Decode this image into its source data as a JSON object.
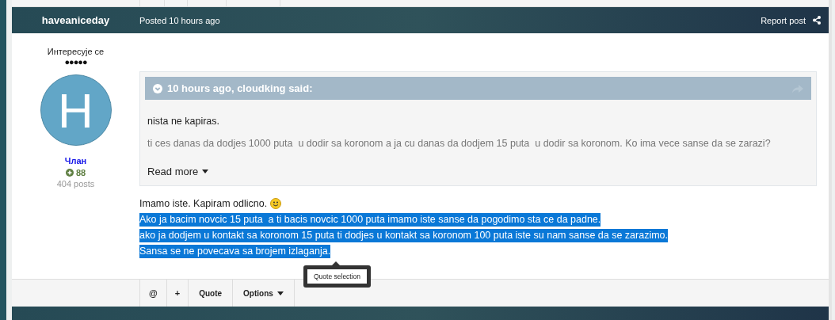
{
  "header": {
    "author": "haveaniceday",
    "posted": "Posted 10 hours ago",
    "report": "Report post"
  },
  "author_panel": {
    "title": "Интересује се",
    "rank_pips": "●●●●●",
    "avatar_letter": "H",
    "group": "Члан",
    "reputation": "88",
    "posts": "404 posts"
  },
  "quote": {
    "citation": "10 hours ago, cloudking said:",
    "read_more": "Read more",
    "paragraphs": [
      {
        "text": "nista ne kapiras.",
        "faded": false
      },
      {
        "text": "ti ces danas da dodjes 1000 puta  u dodir sa koronom a ja cu danas da dodjem 15 puta  u dodir sa koronom. Ko ima vece sanse da se zarazi?",
        "faded": true
      }
    ]
  },
  "content": {
    "lines": [
      {
        "text": "Imamo iste. Kapiram odlicno.",
        "selected": false,
        "emoji": true
      },
      {
        "text": "Ako ja bacim novcic 15 puta  a ti bacis novcic 1000 puta imamo iste sanse da pogodimo sta ce da padne.",
        "selected": true,
        "emoji": false
      },
      {
        "text": "ako ja dodjem u kontakt sa koronom 15 puta ti dodjes u kontakt sa koronom 100 puta iste su nam sanse da se zarazimo.",
        "selected": true,
        "emoji": false
      },
      {
        "text": "Sansa se ne povecava sa brojem izlaganja.",
        "selected": true,
        "emoji": false
      }
    ]
  },
  "tooltip": "Quote selection",
  "actions": [
    {
      "label": "@",
      "dropdown": false
    },
    {
      "label": "+",
      "dropdown": false
    },
    {
      "label": "Quote",
      "dropdown": false
    },
    {
      "label": "Options",
      "dropdown": true
    }
  ]
}
